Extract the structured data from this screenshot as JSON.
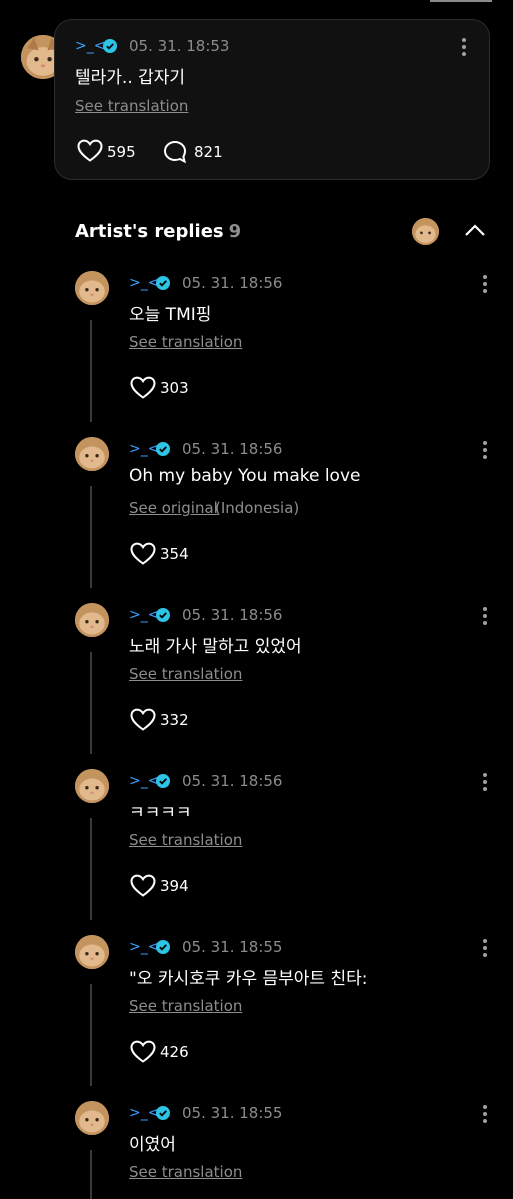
{
  "post": {
    "username": ">_<",
    "timestamp": "05. 31. 18:53",
    "text": "텔라가.. 갑자기",
    "translate_label": "See translation",
    "likes": "595",
    "comments": "821"
  },
  "artist_replies": {
    "title": "Artist's replies",
    "count": "9"
  },
  "replies": [
    {
      "username": ">_<",
      "timestamp": "05. 31. 18:56",
      "text": "오늘 TMI핑",
      "link": "See translation",
      "extra": "",
      "likes": "303"
    },
    {
      "username": ">_<",
      "timestamp": "05. 31. 18:56",
      "text": "Oh my baby You make love",
      "link": "See original",
      "extra": "(Indonesia)",
      "likes": "354"
    },
    {
      "username": ">_<",
      "timestamp": "05. 31. 18:56",
      "text": "노래 가사 말하고 있었어",
      "link": "See translation",
      "extra": "",
      "likes": "332"
    },
    {
      "username": ">_<",
      "timestamp": "05. 31. 18:56",
      "text": "ㅋㅋㅋㅋ",
      "link": "See translation",
      "extra": "",
      "likes": "394"
    },
    {
      "username": ">_<",
      "timestamp": "05. 31. 18:55",
      "text": "\"오 카시호쿠 카우 믐부아트 친타:",
      "link": "See translation",
      "extra": "",
      "likes": "426"
    },
    {
      "username": ">_<",
      "timestamp": "05. 31. 18:55",
      "text": "이였어",
      "link": "See translation",
      "extra": "",
      "likes": ""
    }
  ],
  "colors": {
    "accent": "#3aa0ff",
    "verified": "#2ec4e6",
    "background": "#000000",
    "card": "#111111"
  }
}
